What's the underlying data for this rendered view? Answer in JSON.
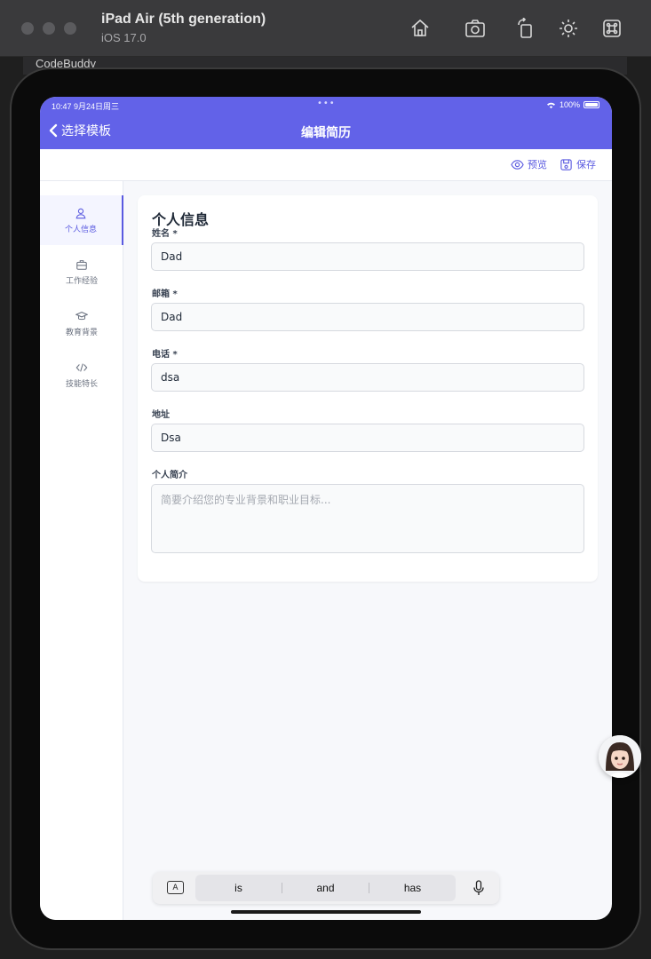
{
  "simulator": {
    "device_name": "iPad Air (5th generation)",
    "os_version": "iOS 17.0",
    "behind_text": "CodeBuddy"
  },
  "status_bar": {
    "time": "10:47  9月24日周三",
    "battery": "100%"
  },
  "nav": {
    "back_label": "选择模板",
    "title": "编辑简历"
  },
  "toolbar": {
    "preview_label": "预览",
    "save_label": "保存"
  },
  "sidebar": {
    "items": [
      {
        "label": "个人信息",
        "icon": "user-icon",
        "active": true
      },
      {
        "label": "工作经验",
        "icon": "briefcase-icon",
        "active": false
      },
      {
        "label": "教育背景",
        "icon": "graduation-cap-icon",
        "active": false
      },
      {
        "label": "技能特长",
        "icon": "code-icon",
        "active": false
      }
    ]
  },
  "form": {
    "title": "个人信息",
    "fields": [
      {
        "label": "姓名 *",
        "value": "Dad"
      },
      {
        "label": "邮箱 *",
        "value": "Dad"
      },
      {
        "label": "电话 *",
        "value": "dsa"
      },
      {
        "label": "地址",
        "value": "Dsa"
      }
    ],
    "bio": {
      "label": "个人简介",
      "placeholder": "简要介绍您的专业背景和职业目标...",
      "value": ""
    }
  },
  "keyboard": {
    "suggestions": [
      "is",
      "and",
      "has"
    ],
    "mode_key": "A"
  },
  "colors": {
    "accent": "#6262e8",
    "screen_bg": "#f7f8fb"
  }
}
